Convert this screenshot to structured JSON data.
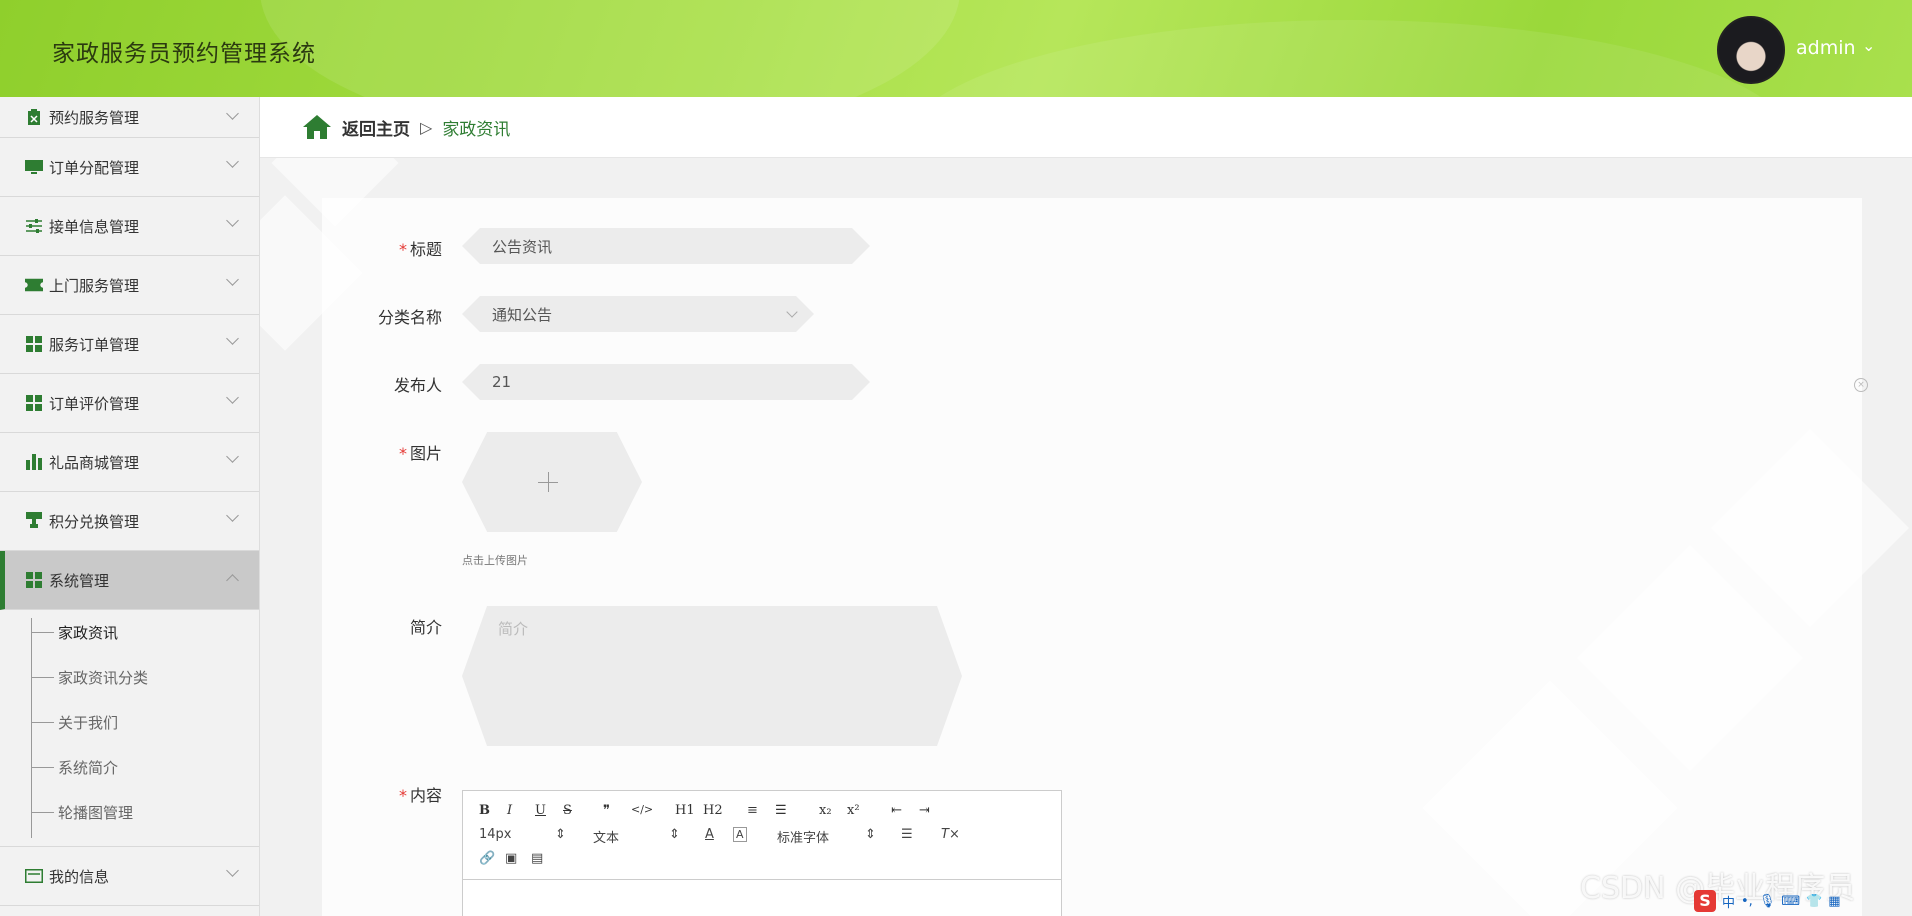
{
  "header": {
    "title": "家政服务员预约管理系统",
    "user": "admin",
    "caret": "⌄"
  },
  "sidebar": {
    "items": [
      {
        "label": "预约服务管理",
        "icon": "clipboard-icon"
      },
      {
        "label": "订单分配管理",
        "icon": "monitor-icon"
      },
      {
        "label": "接单信息管理",
        "icon": "sliders-icon"
      },
      {
        "label": "上门服务管理",
        "icon": "ticket-icon"
      },
      {
        "label": "服务订单管理",
        "icon": "grid-icon"
      },
      {
        "label": "订单评价管理",
        "icon": "grid-icon"
      },
      {
        "label": "礼品商城管理",
        "icon": "bar-chart-icon"
      },
      {
        "label": "积分兑换管理",
        "icon": "stamp-icon"
      },
      {
        "label": "系统管理",
        "icon": "grid-icon"
      }
    ],
    "submenu": [
      "家政资讯",
      "家政资讯分类",
      "关于我们",
      "系统简介",
      "轮播图管理"
    ],
    "last_item": {
      "label": "我的信息",
      "icon": "id-card-icon"
    }
  },
  "breadcrumb": {
    "home": "返回主页",
    "separator": "▷",
    "current": "家政资讯"
  },
  "form": {
    "title_label": "标题",
    "title_value": "公告资讯",
    "category_label": "分类名称",
    "category_value": "通知公告",
    "publisher_label": "发布人",
    "publisher_value": "21",
    "image_label": "图片",
    "image_hint": "点击上传图片",
    "summary_label": "简介",
    "summary_placeholder": "简介",
    "content_label": "内容",
    "required_mark": "*"
  },
  "editor": {
    "row1": [
      "B",
      "I",
      "U",
      "S",
      "❞",
      "</>",
      "H1",
      "H2",
      "≡",
      "☰",
      "x₂",
      "x²",
      "⇤",
      "⇥"
    ],
    "font_size": "14px",
    "text_type": "文本",
    "font_family": "标准字体"
  },
  "watermark": "CSDN @毕业程序员",
  "tray_logo": "S",
  "tray_text": "中"
}
